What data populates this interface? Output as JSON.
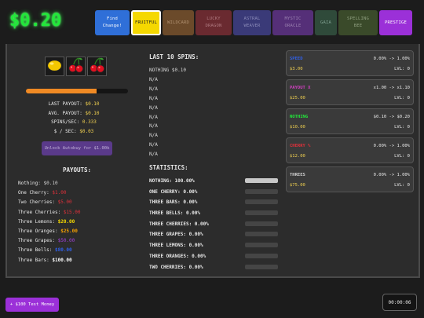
{
  "money": "$0.20",
  "tabs": [
    {
      "lines": [
        "Find",
        "Change!"
      ],
      "bg": "#2f6fd8",
      "color": "#ffffff",
      "border": "none"
    },
    {
      "lines": [
        "FRUITFUL"
      ],
      "bg": "#f5d800",
      "color": "#222222",
      "border": "2px solid #ffffff"
    },
    {
      "lines": [
        "WILDCARD"
      ],
      "bg": "#6b4a2a",
      "color": "#b09070",
      "border": "none"
    },
    {
      "lines": [
        "LUCKY",
        "DRAGON"
      ],
      "bg": "#6a2a30",
      "color": "#b07a80",
      "border": "none"
    },
    {
      "lines": [
        "ASTRAL",
        "WEAVER"
      ],
      "bg": "#3a3a78",
      "color": "#8a8ab8",
      "border": "none"
    },
    {
      "lines": [
        "MYSTIC",
        "ORACLE"
      ],
      "bg": "#552f78",
      "color": "#9a80b0",
      "border": "none"
    },
    {
      "lines": [
        "GAIA"
      ],
      "bg": "#2f4a3a",
      "color": "#80a090",
      "border": "none"
    },
    {
      "lines": [
        "SPELLING",
        "BEE"
      ],
      "bg": "#3a4a2a",
      "color": "#90a080",
      "border": "none"
    },
    {
      "lines": [
        "PRESTIGE"
      ],
      "bg": "#9b30d8",
      "color": "#ffffff",
      "border": "none"
    }
  ],
  "slots": [
    "lemon",
    "cherry",
    "cherry"
  ],
  "progress": 0.69,
  "stats": [
    {
      "label": "LAST PAYOUT:",
      "value": "$0.10"
    },
    {
      "label": "AVG. PAYOUT:",
      "value": "$0.10"
    },
    {
      "label": "SPINS/SEC:",
      "value": "0.333"
    },
    {
      "label": "$ / SEC:",
      "value": "$0.03"
    }
  ],
  "autobuy_label": "Unlock Autobuy for $1.00k",
  "payouts_title": "PAYOUTS:",
  "payouts": [
    {
      "label": "Nothing:",
      "value": "$0.10",
      "color": "#cfcfcf",
      "bold": false
    },
    {
      "label": "One Cherry:",
      "value": "$1.00",
      "color": "#e0303a",
      "bold": false
    },
    {
      "label": "Two Cherries:",
      "value": "$5.00",
      "color": "#e0303a",
      "bold": false
    },
    {
      "label": "Three Cherries:",
      "value": "$15.00",
      "color": "#e0303a",
      "bold": false
    },
    {
      "label": "Three Lemons:",
      "value": "$20.00",
      "color": "#f5d800",
      "bold": true
    },
    {
      "label": "Three Oranges:",
      "value": "$25.00",
      "color": "#f5a000",
      "bold": true
    },
    {
      "label": "Three Grapes:",
      "value": "$50.00",
      "color": "#a040d8",
      "bold": false
    },
    {
      "label": "Three Bells:",
      "value": "$80.00",
      "color": "#3060e8",
      "bold": true
    },
    {
      "label": "Three Bars:",
      "value": "$100.00",
      "color": "#ffffff",
      "bold": true
    }
  ],
  "spins_title": "LAST 10 SPINS:",
  "spins": [
    "NOTHING $0.10",
    "N/A",
    "N/A",
    "N/A",
    "N/A",
    "N/A",
    "N/A",
    "N/A",
    "N/A",
    "N/A"
  ],
  "statistics_title": "STATISTICS:",
  "statistics": [
    {
      "label": "NOTHING: 100.00%",
      "fraction": 1.0
    },
    {
      "label": "ONE CHERRY: 0.00%",
      "fraction": 0
    },
    {
      "label": "THREE BARS: 0.00%",
      "fraction": 0
    },
    {
      "label": "THREE BELLS: 0.00%",
      "fraction": 0
    },
    {
      "label": "THREE CHERRIES: 0.00%",
      "fraction": 0
    },
    {
      "label": "THREE GRAPES: 0.00%",
      "fraction": 0
    },
    {
      "label": "THREE LEMONS: 0.00%",
      "fraction": 0
    },
    {
      "label": "THREE ORANGES: 0.00%",
      "fraction": 0
    },
    {
      "label": "TWO CHERRIES: 0.00%",
      "fraction": 0
    }
  ],
  "upgrades": [
    {
      "name": "SPEED",
      "name_color": "#3060e8",
      "effect": "0.00% -> 1.00%",
      "price": "$3.00",
      "level": "LVL: 0"
    },
    {
      "name": "PAYOUT X",
      "name_color": "#d040c0",
      "effect": "x1.00 -> x1.10",
      "price": "$25.00",
      "level": "LVL: 0"
    },
    {
      "name": "NOTHING",
      "name_color": "#22e83a",
      "effect": "$0.10 -> $0.20",
      "price": "$10.00",
      "level": "LVL: 0"
    },
    {
      "name": "CHERRY %",
      "name_color": "#e0303a",
      "effect": "0.00% -> 1.00%",
      "price": "$12.00",
      "level": "LVL: 0"
    },
    {
      "name": "THREES",
      "name_color": "#cfcfcf",
      "effect": "0.00% -> 1.00%",
      "price": "$75.00",
      "level": "LVL: 0"
    }
  ],
  "test_money_label": "+ $100 Test Money",
  "timer": "00:00:06"
}
